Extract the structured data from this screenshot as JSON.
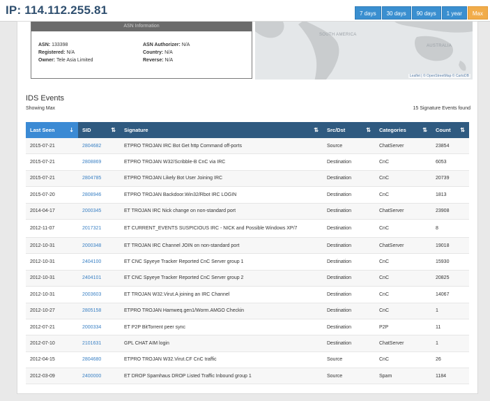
{
  "header": {
    "ip_title": "IP: 114.112.255.81",
    "ranges": [
      {
        "label": "7 days",
        "active": false
      },
      {
        "label": "30 days",
        "active": false
      },
      {
        "label": "90 days",
        "active": false
      },
      {
        "label": "1 year",
        "active": false
      },
      {
        "label": "Max",
        "active": true
      }
    ]
  },
  "asn_info": {
    "heading": "ASN Information",
    "asn_label": "ASN:",
    "asn_value": "133398",
    "registered_label": "Registered:",
    "registered_value": "N/A",
    "owner_label": "Owner:",
    "owner_value": "Tele Asia Limited",
    "authorizer_label": "ASN Authorizer:",
    "authorizer_value": "N/A",
    "country_label": "Country:",
    "country_value": "N/A",
    "reverse_label": "Reverse:",
    "reverse_value": "N/A"
  },
  "map": {
    "label_south_america": "SOUTH AMERICA",
    "label_australia": "AUSTRALIA",
    "attribution": "Leaflet | © OpenStreetMap © CartoDB"
  },
  "ids": {
    "title": "IDS Events",
    "showing": "Showing Max",
    "events_found": "15 Signature Events found",
    "columns": {
      "last_seen": "Last Seen",
      "sid": "SID",
      "signature": "Signature",
      "src_dst": "Src/Dst",
      "categories": "Categories",
      "count": "Count"
    },
    "sort_icon": "sort-icon",
    "rows": [
      {
        "date": "2015-07-21",
        "sid": "2804682",
        "signature": "ETPRO TROJAN IRC Bot Get http Command off-ports",
        "src_dst": "Source",
        "category": "ChatServer",
        "count": "23854"
      },
      {
        "date": "2015-07-21",
        "sid": "2808869",
        "signature": "ETPRO TROJAN W32/Scribble-B CnC via IRC",
        "src_dst": "Destination",
        "category": "CnC",
        "count": "6053"
      },
      {
        "date": "2015-07-21",
        "sid": "2804785",
        "signature": "ETPRO TROJAN Likely Bot User Joining IRC",
        "src_dst": "Destination",
        "category": "CnC",
        "count": "20739"
      },
      {
        "date": "2015-07-20",
        "sid": "2808946",
        "signature": "ETPRO TROJAN Backdoor.Win32/Rbot IRC LOGIN",
        "src_dst": "Destination",
        "category": "CnC",
        "count": "1813"
      },
      {
        "date": "2014-04-17",
        "sid": "2000345",
        "signature": "ET TROJAN IRC Nick change on non-standard port",
        "src_dst": "Destination",
        "category": "ChatServer",
        "count": "23908"
      },
      {
        "date": "2012-11-07",
        "sid": "2017321",
        "signature": "ET CURRENT_EVENTS SUSPICIOUS IRC - NICK and Possible Windows XP/7",
        "src_dst": "Destination",
        "category": "CnC",
        "count": "8"
      },
      {
        "date": "2012-10-31",
        "sid": "2000348",
        "signature": "ET TROJAN IRC Channel JOIN on non-standard port",
        "src_dst": "Destination",
        "category": "ChatServer",
        "count": "19018"
      },
      {
        "date": "2012-10-31",
        "sid": "2404100",
        "signature": "ET CNC Spyeye Tracker Reported CnC Server group 1",
        "src_dst": "Destination",
        "category": "CnC",
        "count": "15930"
      },
      {
        "date": "2012-10-31",
        "sid": "2404101",
        "signature": "ET CNC Spyeye Tracker Reported CnC Server group 2",
        "src_dst": "Destination",
        "category": "CnC",
        "count": "20825"
      },
      {
        "date": "2012-10-31",
        "sid": "2003603",
        "signature": "ET TROJAN W32.Virut.A joining an IRC Channel",
        "src_dst": "Destination",
        "category": "CnC",
        "count": "14067"
      },
      {
        "date": "2012-10-27",
        "sid": "2805158",
        "signature": "ETPRO TROJAN Hamweq.gen1/Worm.AMGO Checkin",
        "src_dst": "Destination",
        "category": "CnC",
        "count": "1"
      },
      {
        "date": "2012-07-21",
        "sid": "2000334",
        "signature": "ET P2P BitTorrent peer sync",
        "src_dst": "Destination",
        "category": "P2P",
        "count": "11"
      },
      {
        "date": "2012-07-10",
        "sid": "2101631",
        "signature": "GPL CHAT AIM login",
        "src_dst": "Destination",
        "category": "ChatServer",
        "count": "1"
      },
      {
        "date": "2012-04-15",
        "sid": "2804680",
        "signature": "ETPRO TROJAN W32.Virut.CF CnC traffic",
        "src_dst": "Source",
        "category": "CnC",
        "count": "26"
      },
      {
        "date": "2012-03-09",
        "sid": "2400000",
        "signature": "ET DROP Spamhaus DROP Listed Traffic Inbound group 1",
        "src_dst": "Source",
        "category": "Spam",
        "count": "1184"
      }
    ]
  }
}
